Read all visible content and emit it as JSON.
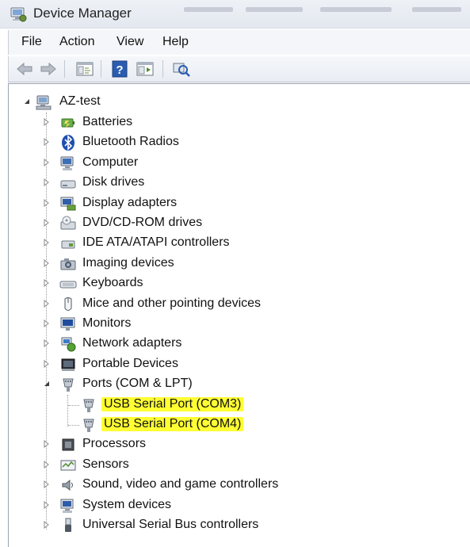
{
  "window": {
    "title": "Device Manager",
    "icon": "device-manager-icon"
  },
  "menu": {
    "items": [
      "File",
      "Action",
      "View",
      "Help"
    ]
  },
  "toolbar": {
    "buttons": [
      {
        "name": "back-arrow-icon"
      },
      {
        "name": "forward-arrow-icon"
      },
      {
        "name": "show-hide-console-tree-icon"
      },
      {
        "name": "help-icon"
      },
      {
        "name": "properties-icon"
      },
      {
        "name": "scan-hardware-icon"
      }
    ]
  },
  "tree": {
    "root": {
      "label": "AZ-test",
      "expanded": true,
      "icon": "computer-icon"
    },
    "categories": [
      {
        "label": "Batteries",
        "icon": "battery-icon",
        "expanded": false
      },
      {
        "label": "Bluetooth Radios",
        "icon": "bluetooth-icon",
        "expanded": false
      },
      {
        "label": "Computer",
        "icon": "computer-icon",
        "expanded": false
      },
      {
        "label": "Disk drives",
        "icon": "disk-drive-icon",
        "expanded": false
      },
      {
        "label": "Display adapters",
        "icon": "display-adapter-icon",
        "expanded": false
      },
      {
        "label": "DVD/CD-ROM drives",
        "icon": "dvd-drive-icon",
        "expanded": false
      },
      {
        "label": "IDE ATA/ATAPI controllers",
        "icon": "ide-controller-icon",
        "expanded": false
      },
      {
        "label": "Imaging devices",
        "icon": "camera-icon",
        "expanded": false
      },
      {
        "label": "Keyboards",
        "icon": "keyboard-icon",
        "expanded": false
      },
      {
        "label": "Mice and other pointing devices",
        "icon": "mouse-icon",
        "expanded": false
      },
      {
        "label": "Monitors",
        "icon": "monitor-icon",
        "expanded": false
      },
      {
        "label": "Network adapters",
        "icon": "network-adapter-icon",
        "expanded": false
      },
      {
        "label": "Portable Devices",
        "icon": "portable-device-icon",
        "expanded": false
      },
      {
        "label": "Ports (COM & LPT)",
        "icon": "port-icon",
        "expanded": true,
        "children": [
          {
            "label": "USB Serial Port (COM3)",
            "icon": "port-icon",
            "highlighted": true
          },
          {
            "label": "USB Serial Port (COM4)",
            "icon": "port-icon",
            "highlighted": true
          }
        ]
      },
      {
        "label": "Processors",
        "icon": "processor-icon",
        "expanded": false
      },
      {
        "label": "Sensors",
        "icon": "sensor-icon",
        "expanded": false
      },
      {
        "label": "Sound, video and game controllers",
        "icon": "speaker-icon",
        "expanded": false
      },
      {
        "label": "System devices",
        "icon": "system-device-icon",
        "expanded": false
      },
      {
        "label": "Universal Serial Bus controllers",
        "icon": "usb-icon",
        "expanded": false
      }
    ]
  },
  "colors": {
    "highlight": "#ffff33",
    "selection_accent": "#2a5db0"
  }
}
